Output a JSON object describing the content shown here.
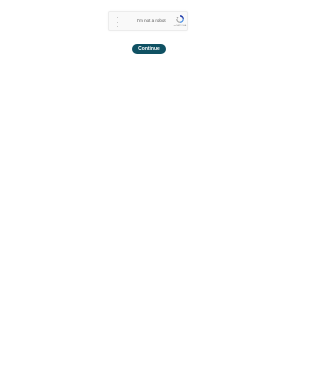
{
  "captcha": {
    "label": "I'm not a robot",
    "brand": "reCAPTCHA",
    "privacy": "Privacy - Terms",
    "logo_icon": "recaptcha-logo-icon",
    "menu_icon": "vertical-dots-icon"
  },
  "actions": {
    "continue_label": "Continue"
  },
  "colors": {
    "button_background": "#0f5163",
    "button_text": "#ffffff",
    "page_background": "#ffffff",
    "captcha_background": "#f9f9f9"
  }
}
